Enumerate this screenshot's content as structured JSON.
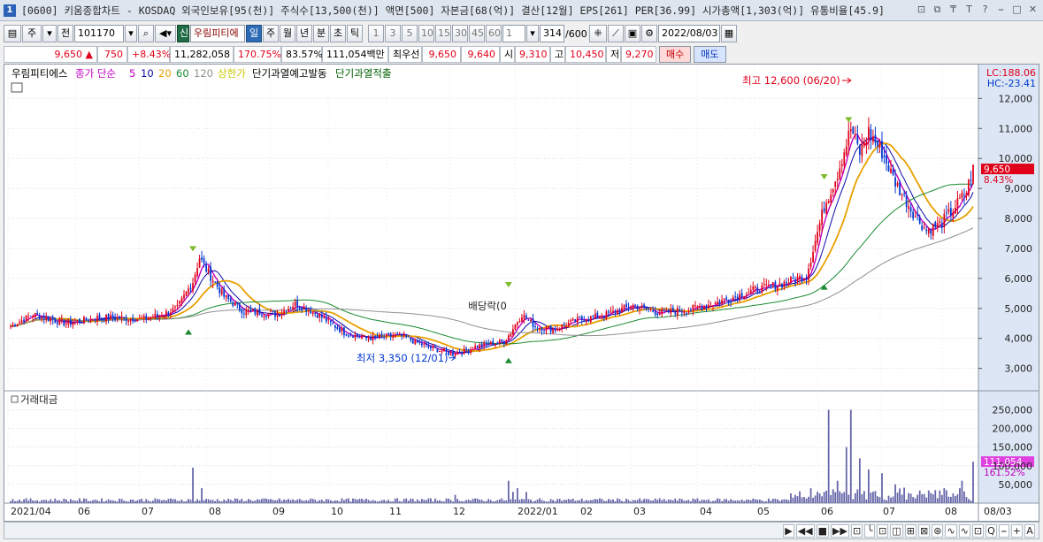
{
  "window": {
    "title": "[0600] 키움종합차트 - KOSDAQ 외국인보유[95(천)] 주식수[13,500(천)] 액면[500] 자본금[68(억)] 결산[12월] EPS[261] PER[36.99] 시가총액[1,303(억)] 유통비율[45.9]",
    "buttons": [
      "⊡",
      "⧉",
      "₸",
      "T",
      "?",
      "⎯",
      "□",
      "✕"
    ]
  },
  "toolbar": {
    "period_sel": "주",
    "list_btn": "전",
    "stock_code": "101170",
    "new_badge": "신",
    "stock_name": "우림피티에",
    "period_tabs": [
      "일",
      "주",
      "월",
      "년",
      "분",
      "초",
      "틱"
    ],
    "active_period": "일",
    "minute_steps": [
      "1",
      "3",
      "5",
      "10",
      "15",
      "30",
      "45",
      "60"
    ],
    "step_value": "1",
    "count": "314",
    "max_count": "/600",
    "date": "2022/08/03"
  },
  "quote": {
    "price": "9,650",
    "arrow": "▲",
    "change": "750",
    "rate": "+8.43%",
    "volume": "11,282,058",
    "vol_rate": "170.75%",
    "turnover": "83.57%",
    "amount": "111,054백만",
    "best_label": "최우선",
    "best_ask": "9,650",
    "best_bid": "9,640",
    "open_label": "시",
    "open": "9,310",
    "high_label": "고",
    "high": "10,450",
    "low_label": "저",
    "low": "9,270",
    "buy_label": "매수",
    "sell_label": "매도"
  },
  "chart": {
    "legend": [
      {
        "text": "우림피티에스",
        "color": "#000000"
      },
      {
        "text": "종가 단순",
        "color": "#c000c0"
      },
      {
        "text": "5",
        "color": "#c000c0"
      },
      {
        "text": "10",
        "color": "#0a0aa8"
      },
      {
        "text": "20",
        "color": "#e8a000"
      },
      {
        "text": "60",
        "color": "#1a8a30"
      },
      {
        "text": "120",
        "color": "#909090"
      },
      {
        "text": "상한가",
        "color": "#c8c800"
      },
      {
        "text": "단기과열예고발동",
        "color": "#000000"
      },
      {
        "text": "단기과열적출",
        "color": "#006000"
      }
    ],
    "lc_label": "LC:188.06",
    "hc_label": "HC:-23.41",
    "price_ticks": [
      "12,000",
      "11,000",
      "10,000",
      "9,000",
      "8,000",
      "7,000",
      "6,000",
      "5,000",
      "4,000",
      "3,000"
    ],
    "current_price_tag": "9,650",
    "current_rate_tag": "8.43%",
    "high_annotation": "최고 12,600 (06/20)",
    "low_annotation": "최저 3,350 (12/01)",
    "dividend_annotation": "배당락(0",
    "volume_title": "거래대금",
    "volume_ticks": [
      "250,000",
      "200,000",
      "150,000",
      "100,000",
      "50,000"
    ],
    "volume_tag": "111,054",
    "volume_rate_tag": "161.52%",
    "x_ticks": [
      "2021/04",
      "06",
      "07",
      "08",
      "09",
      "10",
      "11",
      "12",
      "2022/01",
      "02",
      "03",
      "04",
      "05",
      "06",
      "07",
      "08",
      "08/03"
    ],
    "colors": {
      "up": "#e0001a",
      "down": "#0038d0",
      "ma5": "#c000c0",
      "ma10": "#0a0aa8",
      "ma20": "#e8a000",
      "ma60": "#1a8a30",
      "ma120": "#909090",
      "volume": "#6464a8"
    }
  },
  "chart_data": {
    "type": "candlestick",
    "price_range": [
      2400,
      12600
    ],
    "months": [
      "2021/04",
      "2021/05",
      "2021/06",
      "2021/07",
      "2021/08",
      "2021/09",
      "2021/10",
      "2021/11",
      "2021/12",
      "2022/01",
      "2022/02",
      "2022/03",
      "2022/04",
      "2022/05",
      "2022/06",
      "2022/07",
      "2022/08"
    ],
    "monthly_close": [
      4700,
      4650,
      4700,
      6700,
      5200,
      4900,
      4100,
      4100,
      3700,
      4500,
      4300,
      4700,
      5000,
      5600,
      11000,
      8300,
      9650
    ],
    "volume_ylim": [
      0,
      270000
    ],
    "volume_peak": 250000
  },
  "bottombar": {
    "buttons": [
      "▶",
      "◀◀",
      "■",
      "▶▶",
      "⊡",
      "╰",
      "⊡",
      "◫",
      "⊞",
      "⊠",
      "⊛",
      "∿",
      "∿",
      "⊡",
      "Q",
      "⎯",
      "+",
      "A"
    ]
  }
}
